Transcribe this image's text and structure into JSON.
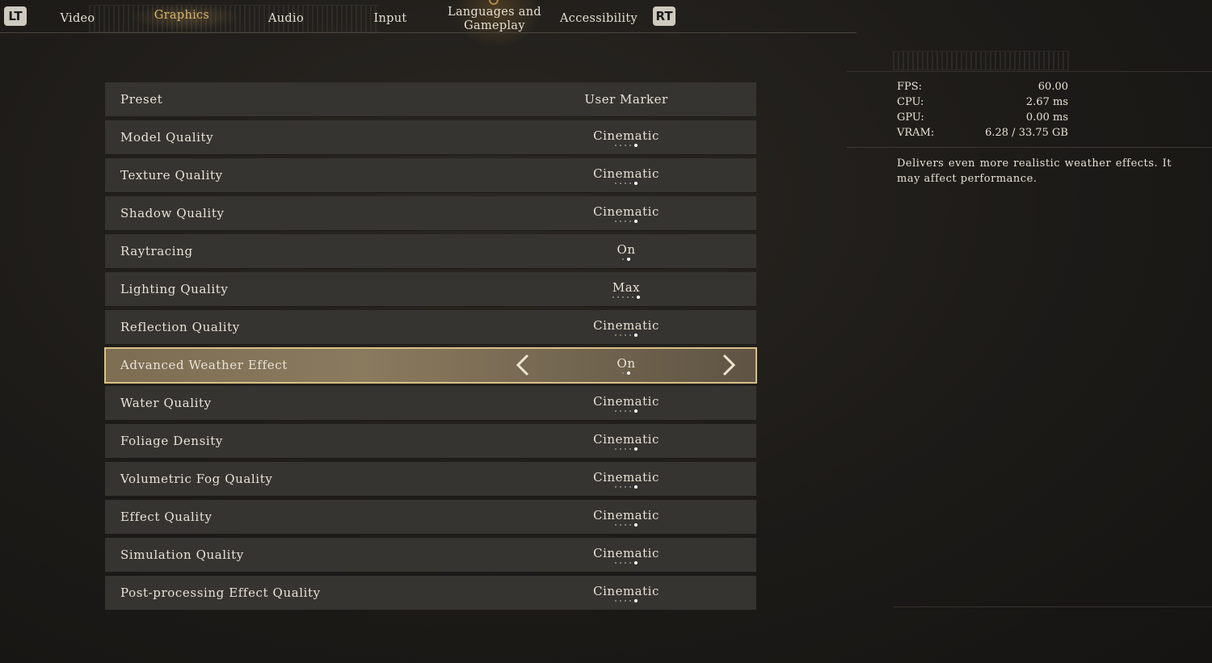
{
  "nav": {
    "lt": "LT",
    "rt": "RT",
    "tabs": [
      {
        "label": "Video"
      },
      {
        "label": "Graphics"
      },
      {
        "label": "Audio"
      },
      {
        "label": "Input"
      },
      {
        "label": "Languages and Gameplay",
        "line1": "Languages and",
        "line2": "Gameplay"
      },
      {
        "label": "Accessibility"
      }
    ],
    "active_tab": "Graphics"
  },
  "settings": [
    {
      "label": "Preset",
      "value": "User Marker"
    },
    {
      "label": "Model Quality",
      "value": "Cinematic",
      "level": 5,
      "levels": 5
    },
    {
      "label": "Texture Quality",
      "value": "Cinematic",
      "level": 5,
      "levels": 5
    },
    {
      "label": "Shadow Quality",
      "value": "Cinematic",
      "level": 5,
      "levels": 5
    },
    {
      "label": "Raytracing",
      "value": "On",
      "level": 2,
      "levels": 2
    },
    {
      "label": "Lighting Quality",
      "value": "Max",
      "level": 6,
      "levels": 6
    },
    {
      "label": "Reflection Quality",
      "value": "Cinematic",
      "level": 5,
      "levels": 5
    },
    {
      "label": "Advanced Weather Effect",
      "value": "On",
      "level": 2,
      "levels": 2,
      "selected": true
    },
    {
      "label": "Water Quality",
      "value": "Cinematic",
      "level": 5,
      "levels": 5
    },
    {
      "label": "Foliage Density",
      "value": "Cinematic",
      "level": 5,
      "levels": 5
    },
    {
      "label": "Volumetric Fog Quality",
      "value": "Cinematic",
      "level": 5,
      "levels": 5
    },
    {
      "label": "Effect Quality",
      "value": "Cinematic",
      "level": 5,
      "levels": 5
    },
    {
      "label": "Simulation Quality",
      "value": "Cinematic",
      "level": 5,
      "levels": 5
    },
    {
      "label": "Post-processing Effect Quality",
      "value": "Cinematic",
      "level": 5,
      "levels": 5
    }
  ],
  "stats": [
    {
      "label": "FPS:",
      "value": "60.00"
    },
    {
      "label": "CPU:",
      "value": "2.67  ms"
    },
    {
      "label": "GPU:",
      "value": "0.00  ms"
    },
    {
      "label": "VRAM:",
      "value": "6.28  /  33.75  GB"
    }
  ],
  "description": "Delivers even more realistic weather effects. It may affect performance.",
  "icons": {
    "left": "chevron-left-icon",
    "right": "chevron-right-icon"
  },
  "colors": {
    "accent": "#d9b56a",
    "selected_border": "#d8bf86",
    "row_bg": "#363431"
  }
}
